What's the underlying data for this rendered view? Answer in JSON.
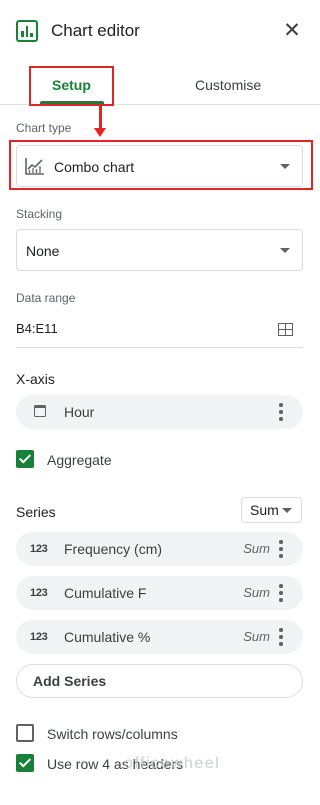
{
  "header": {
    "title": "Chart editor",
    "close_icon": "close-icon"
  },
  "tabs": [
    {
      "label": "Setup",
      "active": true
    },
    {
      "label": "Customise",
      "active": false
    }
  ],
  "accent_color": "#188038",
  "highlight_color": "#e32424",
  "chart_type": {
    "label": "Chart type",
    "value": "Combo chart",
    "icon": "combo-chart-icon"
  },
  "stacking": {
    "label": "Stacking",
    "value": "None"
  },
  "data_range": {
    "label": "Data range",
    "value": "B4:E11",
    "icon": "grid-select-icon"
  },
  "x_axis": {
    "heading": "X-axis",
    "item": {
      "label": "Hour",
      "icon": "calendar-icon"
    },
    "aggregate_label": "Aggregate",
    "aggregate_checked": true
  },
  "series": {
    "heading": "Series",
    "aggregate_select": "Sum",
    "type_icon_text": "123",
    "items": [
      {
        "label": "Frequency (cm)",
        "aggregate": "Sum"
      },
      {
        "label": "Cumulative F",
        "aggregate": "Sum"
      },
      {
        "label": "Cumulative %",
        "aggregate": "Sum"
      }
    ],
    "add_label": "Add Series"
  },
  "options": {
    "switch_rows_label": "Switch rows/columns",
    "switch_rows_checked": false,
    "use_headers_label": "Use row 4 as headers",
    "use_headers_checked": true
  },
  "watermark": "officewheel"
}
